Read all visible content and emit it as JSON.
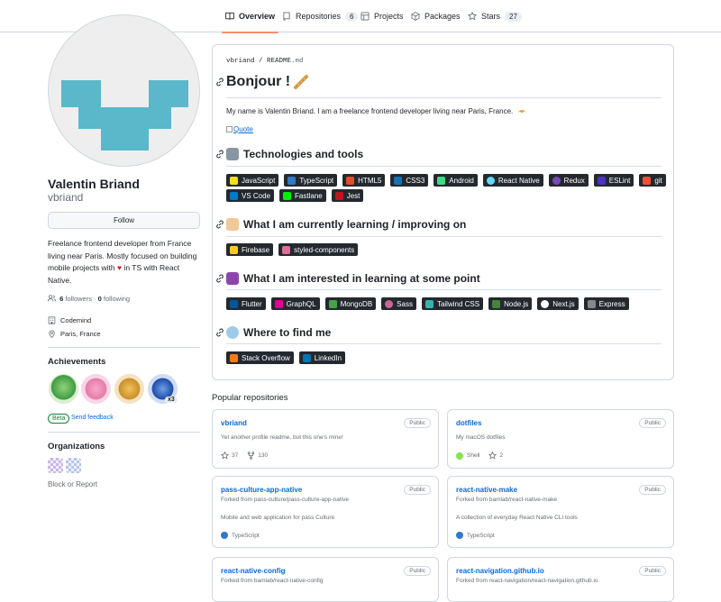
{
  "nav": {
    "tabs": [
      {
        "label": "Overview",
        "icon": "book-icon"
      },
      {
        "label": "Repositories",
        "icon": "repo-icon",
        "count": "6"
      },
      {
        "label": "Projects",
        "icon": "table-icon"
      },
      {
        "label": "Packages",
        "icon": "package-icon"
      },
      {
        "label": "Stars",
        "icon": "star-icon",
        "count": "27"
      }
    ]
  },
  "profile": {
    "name": "Valentin Briand",
    "login": "vbriand",
    "follow_label": "Follow",
    "bio_1": "Freelance frontend developer from France living near Paris. Mostly focused on building mobile projects with",
    "bio_heart": "♥",
    "bio_2": "in TS with React Native.",
    "followers_count": "6",
    "followers_label": "followers",
    "dot": "·",
    "following_count": "0",
    "following_label": "following",
    "company": "Codemind",
    "location": "Paris, France",
    "achievements_title": "Achievements",
    "achievement_extra": "x3",
    "beta_label": "Beta",
    "feedback_label": "Send feedback",
    "orgs_title": "Organizations",
    "block_label": "Block or Report"
  },
  "readme": {
    "path_user": "vbriand",
    "path_sep": " / ",
    "path_file": "README",
    "path_ext": ".md",
    "h1": "Bonjour !",
    "intro": "My name is Valentin Briand. I am a freelance frontend developer living near Paris, France.",
    "quote_alt": "Quote",
    "sections": [
      {
        "title": "Technologies and tools",
        "chips": [
          "JavaScript",
          "TypeScript",
          "HTML5",
          "CSS3",
          "Android",
          "React Native",
          "Redux",
          "ESLint",
          "git",
          "VS Code",
          "Fastlane",
          "Jest"
        ]
      },
      {
        "title": "What I am currently learning / improving on",
        "chips": [
          "Firebase",
          "styled-components"
        ]
      },
      {
        "title": "What I am interested in learning at some point",
        "chips": [
          "Flutter",
          "GraphQL",
          "MongoDB",
          "Sass",
          "Tailwind CSS",
          "Node.js",
          "Next.js",
          "Express"
        ]
      },
      {
        "title": "Where to find me",
        "chips": [
          "Stack Overflow",
          "LinkedIn"
        ]
      }
    ]
  },
  "popular": {
    "title": "Popular repositories",
    "public_label": "Public",
    "repos": [
      {
        "name": "vbriand",
        "desc": "Yet another profile readme, but this one's mine!",
        "stars": "37",
        "forks": "130"
      },
      {
        "name": "dotfiles",
        "desc": "My macOS dotfiles",
        "language": "Shell",
        "stars": "2"
      },
      {
        "name": "pass-culture-app-native",
        "fork": "Forked from pass-culture/pass-culture-app-native",
        "desc": "Mobile and web application for pass Culture",
        "language": "TypeScript"
      },
      {
        "name": "react-native-make",
        "fork": "Forked from bamlab/react-native-make",
        "desc": "A collection of everyday React Native CLI tools",
        "language": "TypeScript"
      },
      {
        "name": "react-native-config",
        "fork": "Forked from bamlab/react-native-config"
      },
      {
        "name": "react-navigation.github.io",
        "fork": "Forked from react-navigation/react-navigation.github.io"
      }
    ]
  },
  "colors": {
    "accent_link": "#0969da",
    "tab_underline": "#fd8c73",
    "heart": "#cf222e",
    "shell": "#89e051",
    "typescript": "#3178c6",
    "avatar_logo": "#5bb7ca"
  }
}
